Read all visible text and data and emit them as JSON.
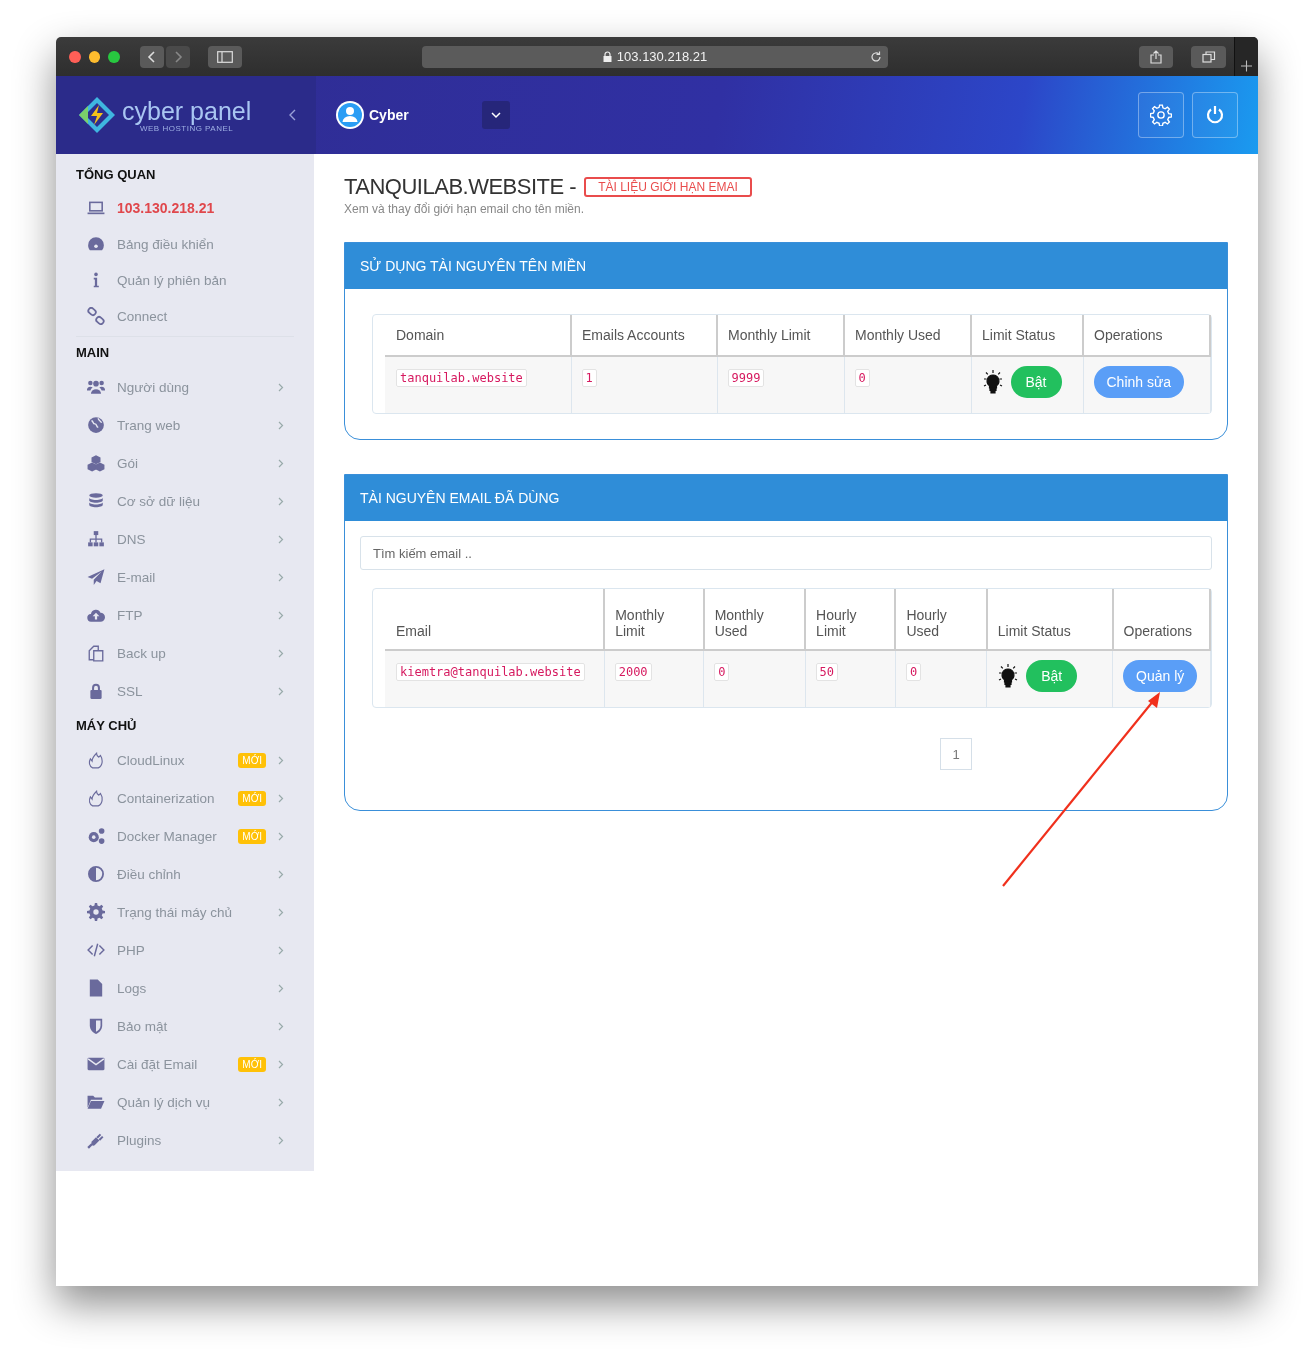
{
  "browser": {
    "address": "103.130.218.21"
  },
  "brand": {
    "name": "cyber panel",
    "tagline": "WEB HOSTING PANEL"
  },
  "user": {
    "name": "Cyber"
  },
  "sidebar": {
    "sections": [
      {
        "title": "TỔNG QUAN",
        "items": [
          {
            "label": "103.130.218.21",
            "selected": true,
            "chevron": false
          },
          {
            "label": "Bảng điều khiển",
            "selected": false,
            "chevron": false
          },
          {
            "label": "Quản lý phiên bản",
            "selected": false,
            "chevron": false
          },
          {
            "label": "Connect",
            "selected": false,
            "chevron": false
          }
        ]
      },
      {
        "title": "MAIN",
        "items": [
          {
            "label": "Người dùng",
            "selected": false,
            "chevron": true
          },
          {
            "label": "Trang web",
            "selected": false,
            "chevron": true
          },
          {
            "label": "Gói",
            "selected": false,
            "chevron": true
          },
          {
            "label": "Cơ sở dữ liệu",
            "selected": false,
            "chevron": true
          },
          {
            "label": "DNS",
            "selected": false,
            "chevron": true
          },
          {
            "label": "E-mail",
            "selected": false,
            "chevron": true
          },
          {
            "label": "FTP",
            "selected": false,
            "chevron": true
          },
          {
            "label": "Back up",
            "selected": false,
            "chevron": true
          },
          {
            "label": "SSL",
            "selected": false,
            "chevron": true
          }
        ]
      },
      {
        "title": "MÁY CHỦ",
        "items": [
          {
            "label": "CloudLinux",
            "badge": "MỚI",
            "selected": false,
            "chevron": true
          },
          {
            "label": "Containerization",
            "badge": "MỚI",
            "selected": false,
            "chevron": true
          },
          {
            "label": "Docker Manager",
            "badge": "MỚI",
            "selected": false,
            "chevron": true
          },
          {
            "label": "Điều chỉnh",
            "selected": false,
            "chevron": true
          },
          {
            "label": "Trạng thái máy chủ",
            "selected": false,
            "chevron": true
          },
          {
            "label": "PHP",
            "selected": false,
            "chevron": true
          },
          {
            "label": "Logs",
            "selected": false,
            "chevron": true
          },
          {
            "label": "Bảo mật",
            "selected": false,
            "chevron": true
          },
          {
            "label": "Cài đặt Email",
            "badge": "MỚI",
            "selected": false,
            "chevron": true
          },
          {
            "label": "Quản lý dịch vụ",
            "selected": false,
            "chevron": true
          },
          {
            "label": "Plugins",
            "selected": false,
            "chevron": true
          }
        ]
      }
    ]
  },
  "page": {
    "title": "TANQUILAB.WEBSITE -",
    "badge": "TÀI LIỆU GIỚI HẠN EMAI",
    "subtitle": "Xem và thay đổi giới hạn email cho tên miền."
  },
  "domain_panel": {
    "title": "SỬ DỤNG TÀI NGUYÊN TÊN MIỀN",
    "columns": [
      "Domain",
      "Emails Accounts",
      "Monthly Limit",
      "Monthly Used",
      "Limit Status",
      "Operations"
    ],
    "rows": [
      {
        "cells": [
          "tanquilab.website",
          "1",
          "9999",
          "0"
        ],
        "limit_status": "Bật",
        "operation": "Chỉnh sửa"
      }
    ]
  },
  "email_panel": {
    "title": "TÀI NGUYÊN EMAIL ĐÃ DÙNG",
    "search": {
      "placeholder": "Tìm kiếm email .."
    },
    "columns": [
      "Email",
      "Monthly Limit",
      "Monthly Used",
      "Hourly Limit",
      "Hourly Used",
      "Limit Status",
      "Operations"
    ],
    "rows": [
      {
        "cells": [
          "kiemtra@tanquilab.website",
          "2000",
          "0",
          "50",
          "0"
        ],
        "limit_status": "Bật",
        "operation": "Quản lý"
      }
    ],
    "pages": [
      "1"
    ]
  }
}
